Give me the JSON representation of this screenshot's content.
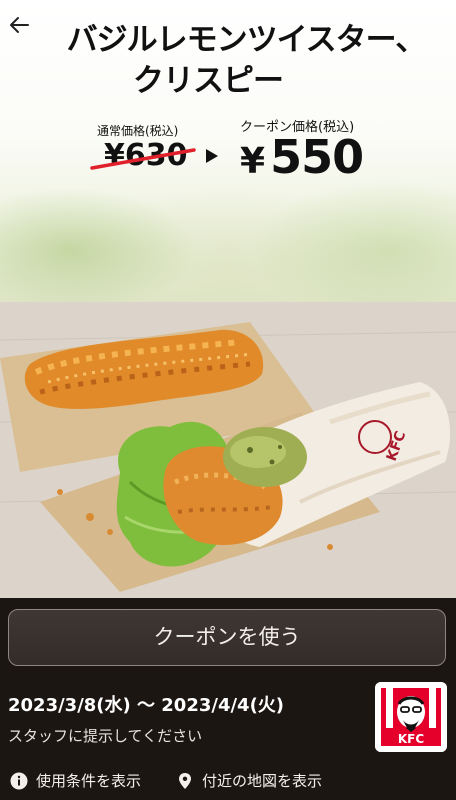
{
  "header": {
    "back_icon": "arrow-left-icon",
    "title_line1": "バジルレモンツイスター、",
    "title_line2": "クリスピー"
  },
  "price": {
    "regular_label": "通常価格(税込)",
    "regular_value": "¥630",
    "coupon_label": "クーポン価格(税込)",
    "coupon_yen": "¥",
    "coupon_value": "550",
    "strike_color": "#e0202a"
  },
  "photo": {
    "wrap_text": "KFC"
  },
  "action": {
    "use_coupon_label": "クーポンを使う"
  },
  "validity": {
    "date_range": "2023/3/8(水) 〜 2023/4/4(火)",
    "note": "スタッフに提示してください"
  },
  "brand": {
    "logo_text": "KFC",
    "brand_red": "#e4002b"
  },
  "footer": {
    "terms_label": "使用条件を表示",
    "terms_icon": "info-icon",
    "map_label": "付近の地図を表示",
    "map_icon": "map-pin-icon"
  }
}
